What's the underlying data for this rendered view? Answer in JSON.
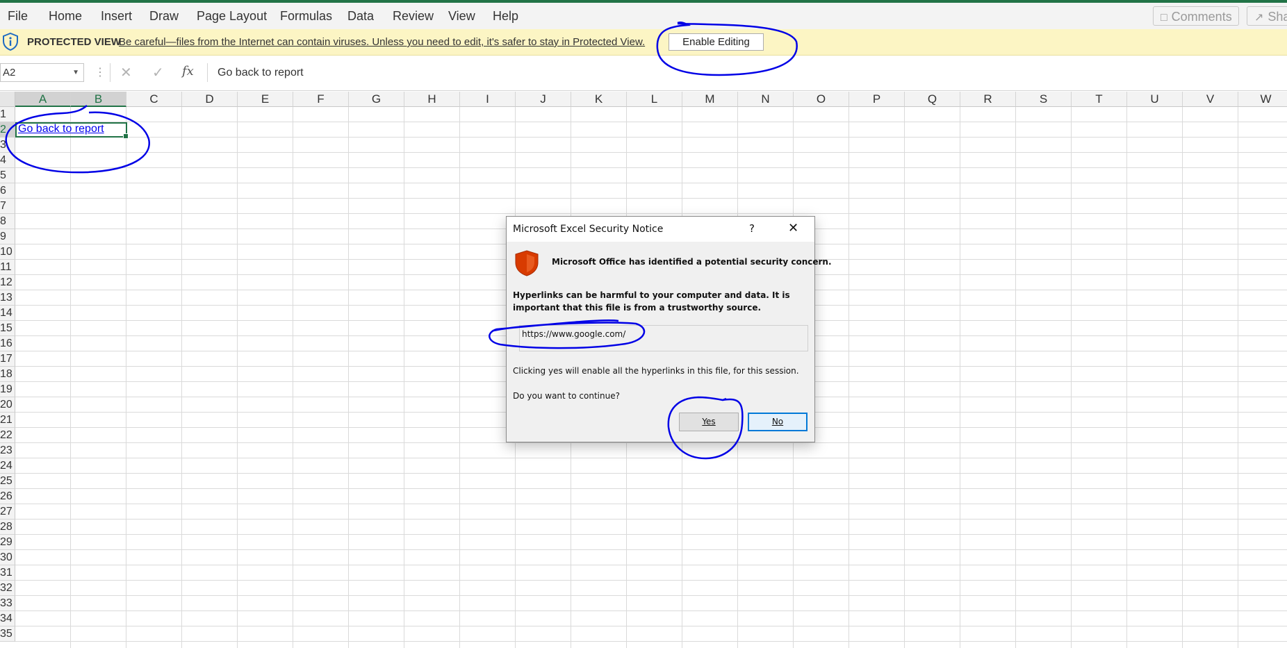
{
  "menu": {
    "items": [
      "File",
      "Home",
      "Insert",
      "Draw",
      "Page Layout",
      "Formulas",
      "Data",
      "Review",
      "View",
      "Help"
    ],
    "comments_label": "Comments",
    "share_label": "Sha"
  },
  "protected_view": {
    "title": "PROTECTED VIEW",
    "message": "Be careful—files from the Internet can contain viruses. Unless you need to edit, it's safer to stay in Protected View.",
    "button": "Enable Editing",
    "icon": "shield-info-icon"
  },
  "formula_bar": {
    "name_box": "A2",
    "fx": "fx",
    "value": "Go back to report"
  },
  "grid": {
    "columns": [
      "A",
      "B",
      "C",
      "D",
      "E",
      "F",
      "G",
      "H",
      "I",
      "J",
      "K",
      "L",
      "M",
      "N",
      "O",
      "P",
      "Q",
      "R",
      "S",
      "T",
      "U",
      "V",
      "W"
    ],
    "rows": [
      "1",
      "2",
      "3",
      "4",
      "5",
      "6",
      "7",
      "8",
      "9",
      "10",
      "11",
      "12",
      "13",
      "14",
      "15",
      "16",
      "17",
      "18",
      "19",
      "20",
      "21",
      "22",
      "23",
      "24",
      "25",
      "26",
      "27",
      "28",
      "29",
      "30",
      "31",
      "32",
      "33",
      "34",
      "35"
    ],
    "selected_columns": [
      "A",
      "B"
    ],
    "selected_row": "2",
    "cell_a2": "Go back to report"
  },
  "dialog": {
    "title": "Microsoft Excel Security Notice",
    "help": "?",
    "heading": "Microsoft Office has identified a potential security concern.",
    "body": "Hyperlinks can be harmful to your computer and data. It is important that this file is from a trustworthy source.",
    "url": "https://www.google.com/",
    "text1": "Clicking yes will enable all the hyperlinks in this file, for this session.",
    "text2": "Do you want to continue?",
    "yes": "Yes",
    "no": "No"
  },
  "colors": {
    "excel_green": "#217346",
    "pv_bar": "#fcf5c4",
    "shield_orange": "#d83b01",
    "annotation_blue": "#0000e6",
    "link": "#0000ee"
  }
}
